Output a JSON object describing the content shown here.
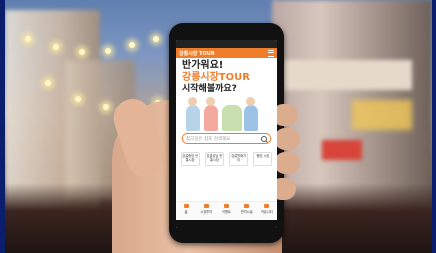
{
  "app": {
    "header_logo": "강릉시장 TOUR"
  },
  "hero": {
    "greeting": "반가워요!",
    "title": "강릉시장TOUR",
    "question": "시작해볼까요?"
  },
  "search": {
    "placeholder": "찾고싶은 점포 검색해요"
  },
  "quick_buttons": [
    {
      "label": "강릉중앙 전통시장"
    },
    {
      "label": "강릉성남 전통시장"
    },
    {
      "label": "강릉월화거리"
    },
    {
      "label": "중앙 시장"
    }
  ],
  "nav": [
    {
      "label": "홈"
    },
    {
      "label": "시장투어"
    },
    {
      "label": "이벤트"
    },
    {
      "label": "편의시설"
    },
    {
      "label": "커뮤니티"
    }
  ],
  "colors": {
    "accent": "#f07d2a",
    "frame": "#0b1e6e"
  }
}
